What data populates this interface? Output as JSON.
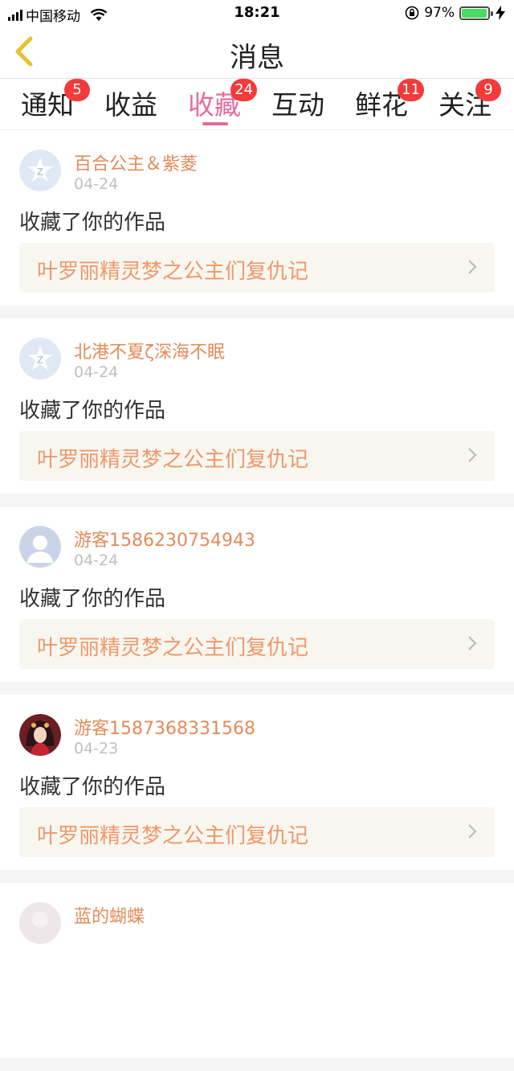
{
  "status_bar": {
    "carrier": "中国移动",
    "time": "18:21",
    "battery_percent": "97%",
    "battery_level": 0.97
  },
  "nav": {
    "title": "消息"
  },
  "tabs": [
    {
      "label": "通知",
      "badge": "5"
    },
    {
      "label": "收益",
      "badge": ""
    },
    {
      "label": "收藏",
      "badge": "24"
    },
    {
      "label": "互动",
      "badge": ""
    },
    {
      "label": "鲜花",
      "badge": "11"
    },
    {
      "label": "关注",
      "badge": "9"
    }
  ],
  "colors": {
    "active_tab": "#e56b9f",
    "badge": "#f23b3b",
    "username": "#e38b5a",
    "work_title": "#f0976a"
  },
  "items": [
    {
      "user": "百合公主＆紫菱",
      "date": "04-24",
      "action": "收藏了你的作品",
      "work": "叶罗丽精灵梦之公主们复仇记",
      "avatar": "qq-default-icon"
    },
    {
      "user": "北港不夏ζ深海不眠",
      "date": "04-24",
      "action": "收藏了你的作品",
      "work": "叶罗丽精灵梦之公主们复仇记",
      "avatar": "qq-default-icon"
    },
    {
      "user": "游客1586230754943",
      "date": "04-24",
      "action": "收藏了你的作品",
      "work": "叶罗丽精灵梦之公主们复仇记",
      "avatar": "guest-avatar-icon"
    },
    {
      "user": "游客1587368331568",
      "date": "04-23",
      "action": "收藏了你的作品",
      "work": "叶罗丽精灵梦之公主们复仇记",
      "avatar": "anime-avatar"
    },
    {
      "user": "蓝的蝴蝶",
      "date": "",
      "action": "",
      "work": "",
      "avatar": "partial-avatar"
    }
  ]
}
